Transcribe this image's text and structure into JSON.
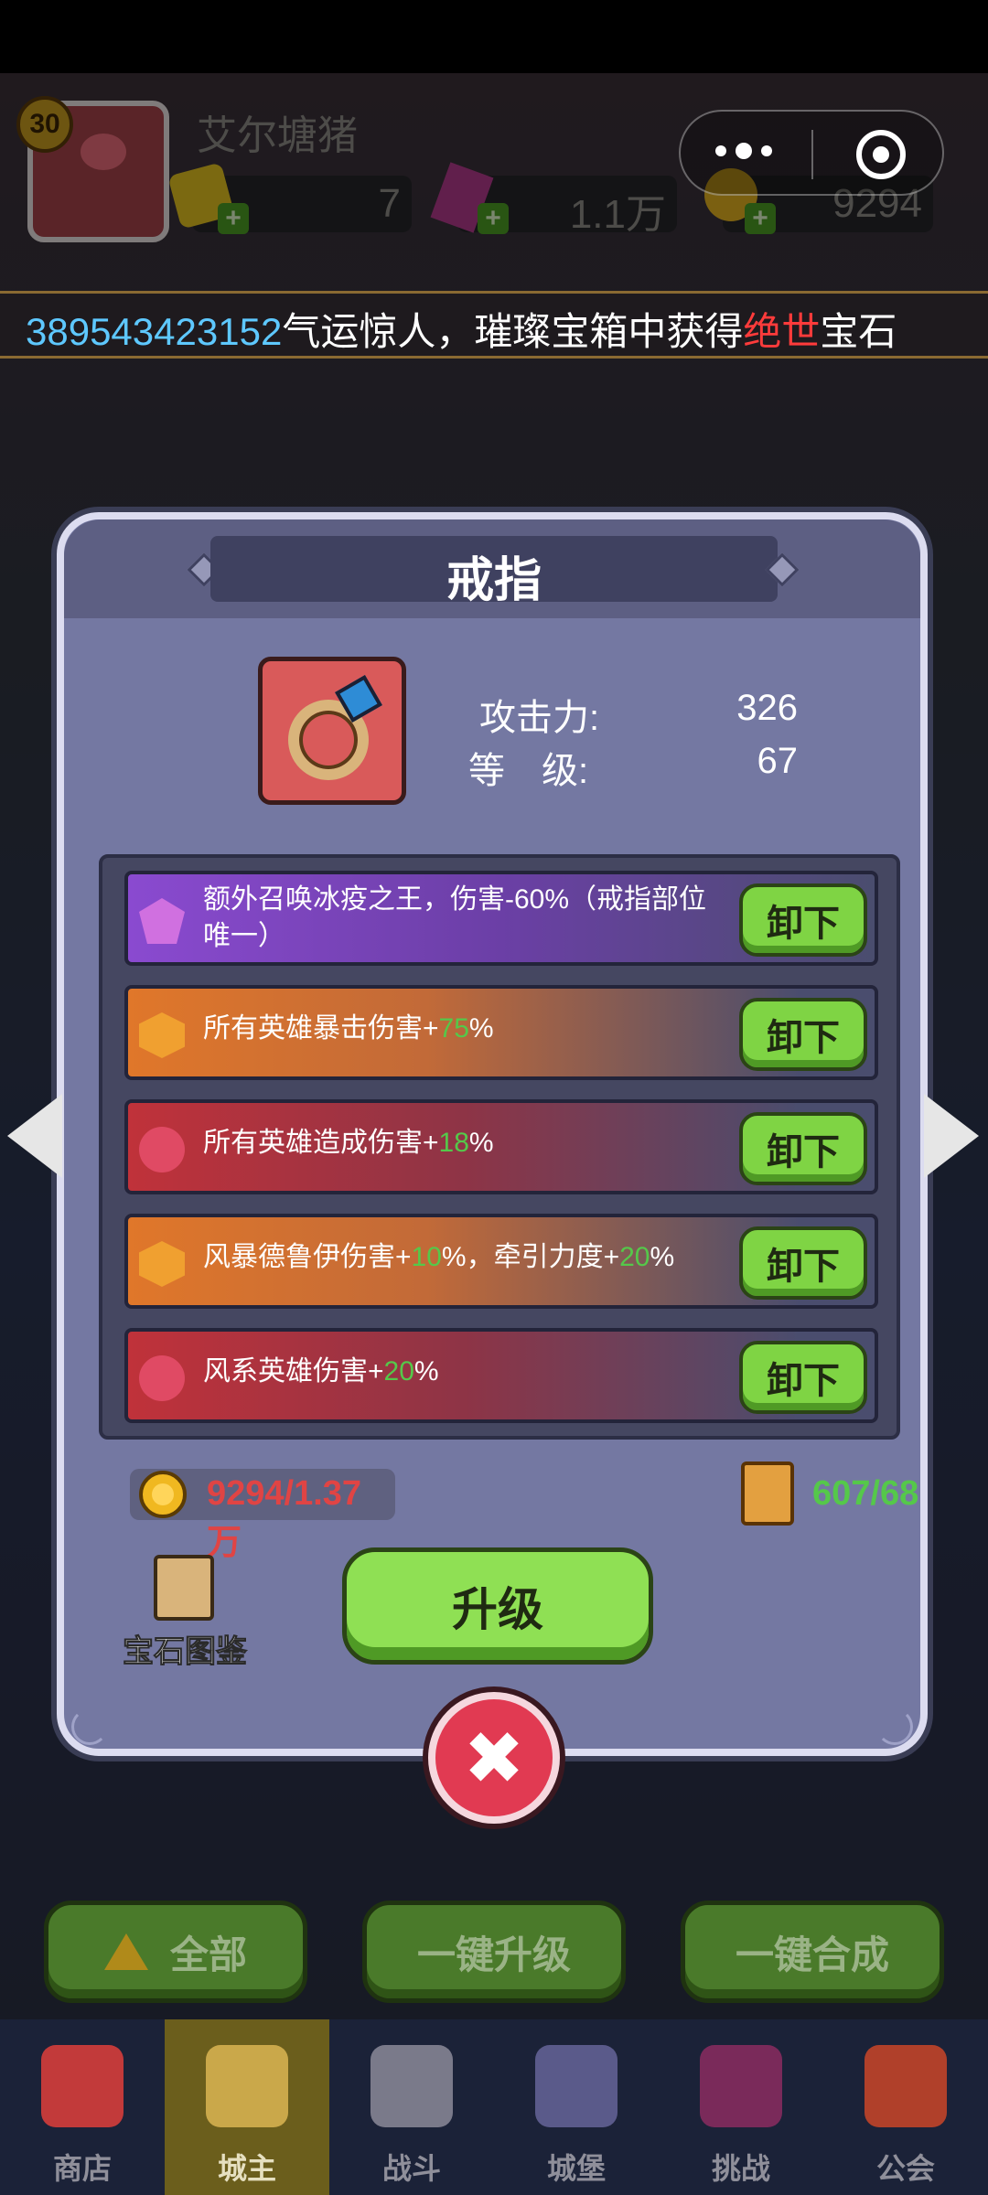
{
  "player": {
    "level": "30",
    "name": "艾尔塘猪"
  },
  "resources": [
    {
      "name": "gold-bar",
      "value": "7"
    },
    {
      "name": "gem",
      "value": "1.1万"
    },
    {
      "name": "coin",
      "value": "9294"
    }
  ],
  "marquee": {
    "prefix": "389543423152",
    "text1": "气运惊人，璀璨宝箱中获得",
    "highlight": "绝世",
    "text2": "宝石"
  },
  "modal": {
    "title": "戒指",
    "stats": [
      {
        "label": "攻击力:",
        "value": "326"
      },
      {
        "label": "等　级:",
        "value": "67"
      }
    ],
    "skills": [
      {
        "type": "purple",
        "text": "额外召唤冰疫之王，伤害-60%（戒指部位唯一）",
        "button": "卸下"
      },
      {
        "type": "orange",
        "pre": "所有英雄暴击伤害+",
        "num": "75",
        "post": "%",
        "button": "卸下"
      },
      {
        "type": "red",
        "pre": "所有英雄造成伤害+",
        "num": "18",
        "post": "%",
        "button": "卸下"
      },
      {
        "type": "orange",
        "pre": "风暴德鲁伊伤害+",
        "num": "10",
        "mid": "%，牵引力度+",
        "num2": "20",
        "post": "%",
        "button": "卸下"
      },
      {
        "type": "red",
        "pre": "风系英雄伤害+",
        "num": "20",
        "post": "%",
        "button": "卸下"
      }
    ],
    "cost": "9294/1.37万",
    "scroll": "607/68",
    "gem_guide": "宝石图鉴",
    "upgrade": "升级",
    "close": "✖"
  },
  "bottom_buttons": [
    "全部",
    "一键升级",
    "一键合成"
  ],
  "nav": [
    {
      "label": "商店",
      "active": false
    },
    {
      "label": "城主",
      "active": true
    },
    {
      "label": "战斗",
      "active": false
    },
    {
      "label": "城堡",
      "active": false
    },
    {
      "label": "挑战",
      "active": false
    },
    {
      "label": "公会",
      "active": false
    }
  ],
  "colors": {
    "accent_green": "#55c84a",
    "warn_red": "#e04444",
    "button_green": "#7fd444",
    "close_red": "#e13a52"
  }
}
